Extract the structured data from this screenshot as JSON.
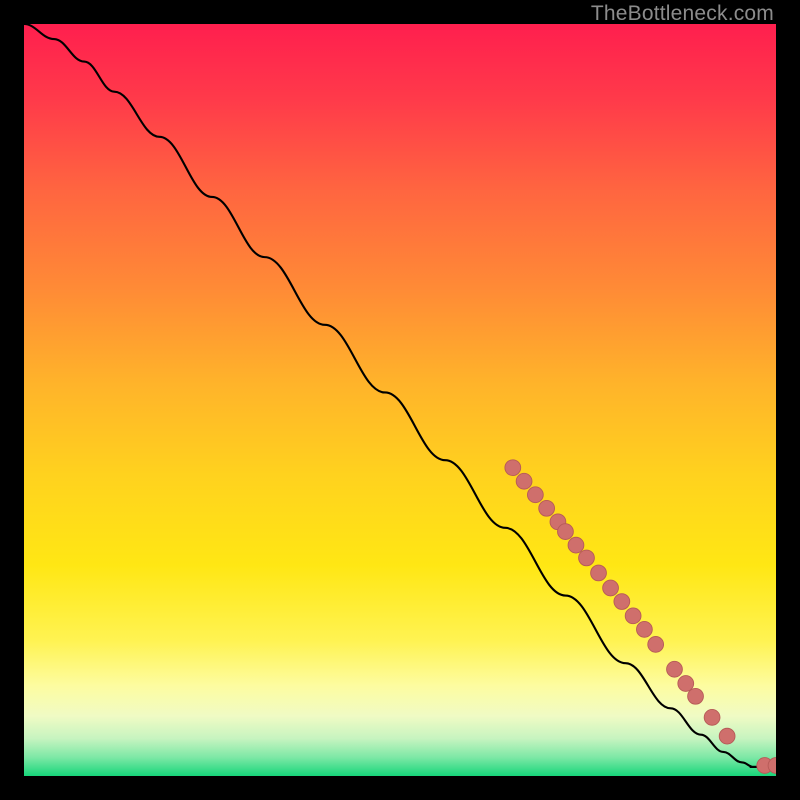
{
  "watermark": "TheBottleneck.com",
  "colors": {
    "background": "#000000",
    "curve_stroke": "#000000",
    "marker_fill": "#cf6f6c",
    "marker_stroke": "#b65a57"
  },
  "chart_data": {
    "type": "line",
    "title": "",
    "xlabel": "",
    "ylabel": "",
    "xlim": [
      0,
      100
    ],
    "ylim": [
      0,
      100
    ],
    "grid": false,
    "curve_interpretation": "Smooth monotone curve from top-left to bottom-right representing some performance/bottleneck relation; no axis ticks are visible so values are normalized 0-100 in both axes.",
    "series": [
      {
        "name": "curve",
        "x": [
          0,
          4,
          8,
          12,
          18,
          25,
          32,
          40,
          48,
          56,
          64,
          72,
          80,
          86,
          90,
          93,
          95.5,
          97,
          100
        ],
        "y": [
          100,
          98,
          95,
          91,
          85,
          77,
          69,
          60,
          51,
          42,
          33,
          24,
          15,
          9,
          5.5,
          3.2,
          1.8,
          1.2,
          1.2
        ]
      }
    ],
    "markers": {
      "name": "highlighted-points",
      "comment": "Salmon dots clustered along the lower-right portion of the curve.",
      "points": [
        {
          "x": 65.0,
          "y": 41.0
        },
        {
          "x": 66.5,
          "y": 39.2
        },
        {
          "x": 68.0,
          "y": 37.4
        },
        {
          "x": 69.5,
          "y": 35.6
        },
        {
          "x": 71.0,
          "y": 33.8
        },
        {
          "x": 72.0,
          "y": 32.5
        },
        {
          "x": 73.4,
          "y": 30.7
        },
        {
          "x": 74.8,
          "y": 29.0
        },
        {
          "x": 76.4,
          "y": 27.0
        },
        {
          "x": 78.0,
          "y": 25.0
        },
        {
          "x": 79.5,
          "y": 23.2
        },
        {
          "x": 81.0,
          "y": 21.3
        },
        {
          "x": 82.5,
          "y": 19.5
        },
        {
          "x": 84.0,
          "y": 17.5
        },
        {
          "x": 86.5,
          "y": 14.2
        },
        {
          "x": 88.0,
          "y": 12.3
        },
        {
          "x": 89.3,
          "y": 10.6
        },
        {
          "x": 91.5,
          "y": 7.8
        },
        {
          "x": 93.5,
          "y": 5.3
        },
        {
          "x": 98.5,
          "y": 1.4
        },
        {
          "x": 100.0,
          "y": 1.4
        }
      ]
    },
    "background_gradient": {
      "type": "vertical-linear",
      "stops": [
        {
          "offset": 0.0,
          "color": "#ff1f4e"
        },
        {
          "offset": 0.1,
          "color": "#ff3a4a"
        },
        {
          "offset": 0.22,
          "color": "#ff6540"
        },
        {
          "offset": 0.35,
          "color": "#ff8a36"
        },
        {
          "offset": 0.48,
          "color": "#ffb42a"
        },
        {
          "offset": 0.6,
          "color": "#ffd21e"
        },
        {
          "offset": 0.72,
          "color": "#ffe714"
        },
        {
          "offset": 0.82,
          "color": "#fff352"
        },
        {
          "offset": 0.88,
          "color": "#fdfca0"
        },
        {
          "offset": 0.92,
          "color": "#f0fbc4"
        },
        {
          "offset": 0.95,
          "color": "#c7f4c0"
        },
        {
          "offset": 0.975,
          "color": "#7ee8a6"
        },
        {
          "offset": 1.0,
          "color": "#17d67a"
        }
      ]
    }
  }
}
